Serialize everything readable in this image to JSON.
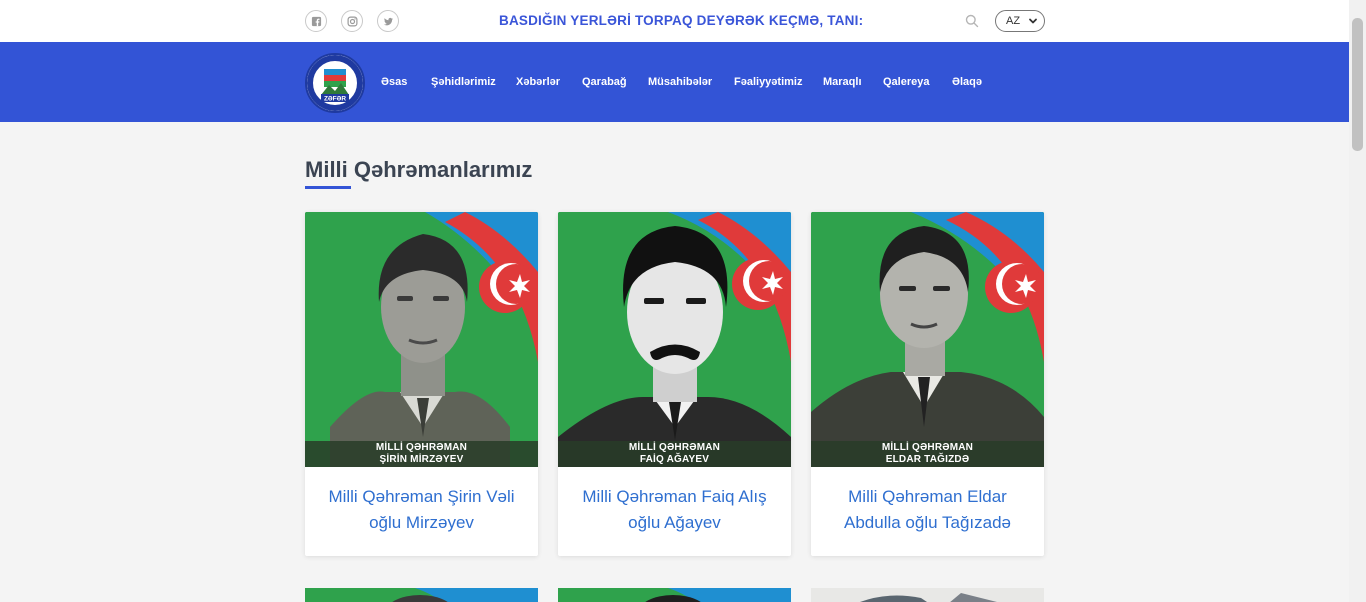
{
  "topbar": {
    "social_icons": [
      "facebook-icon",
      "instagram-icon",
      "twitter-icon"
    ],
    "slogan": "BASDIĞIN YERLƏRİ TORPAQ DEYƏRƏK KEÇMƏ, TANI:",
    "language": "AZ"
  },
  "logo": {
    "text": "ZƏFƏR"
  },
  "nav": {
    "items": [
      "Əsas",
      "Şəhidlərimiz",
      "Xəbərlər",
      "Qarabağ",
      "Müsahibələr",
      "Fəaliyyətimiz",
      "Maraqlı",
      "Qalereya",
      "Əlaqə"
    ]
  },
  "section": {
    "title": "Milli Qəhrəmanlarımız"
  },
  "cards": [
    {
      "caption_line1": "MİLLİ QƏHRƏMAN",
      "caption_line2": "ŞİRİN MİRZƏYEV",
      "title_line1": "Milli Qəhrəman Şirin Vəli",
      "title_line2": "oğlu Mirzəyev"
    },
    {
      "caption_line1": "MİLLİ QƏHRƏMAN",
      "caption_line2": "FAİQ AĞAYEV",
      "title_line1": "Milli Qəhrəman Faiq Alış",
      "title_line2": "oğlu Ağayev"
    },
    {
      "caption_line1": "MİLLİ QƏHRƏMAN",
      "caption_line2": "ELDAR TAĞIZDƏ",
      "title_line1": "Milli Qəhrəman Eldar",
      "title_line2": "Abdulla oğlu Tağızadə"
    }
  ],
  "colors": {
    "accent": "#3354d6",
    "flag_blue": "#1f8fd1",
    "flag_red": "#e03a3a",
    "flag_green": "#2fa24c",
    "link": "#2f6fd0"
  }
}
